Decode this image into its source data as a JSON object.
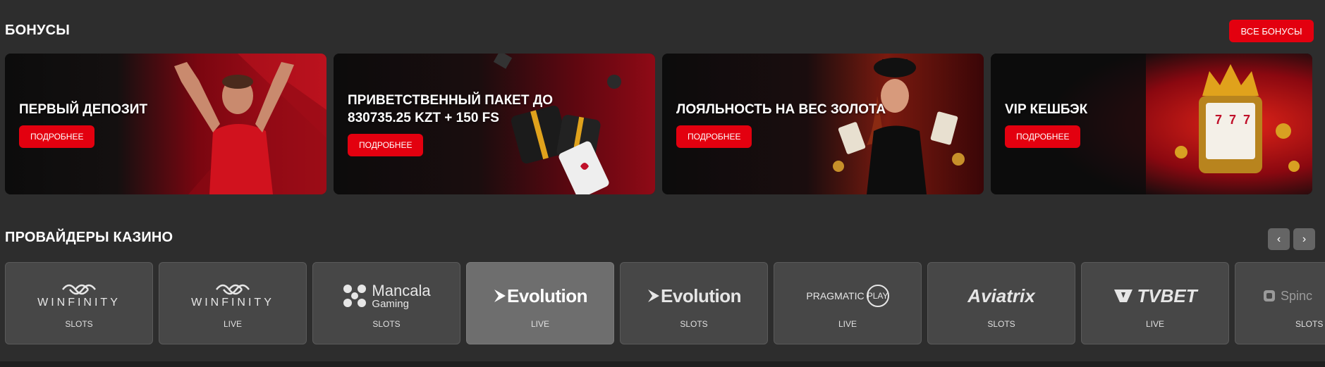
{
  "bonuses": {
    "title": "БОНУСЫ",
    "all_button": "ВСЕ БОНУСЫ",
    "cards": [
      {
        "title": "ПЕРВЫЙ ДЕПОЗИТ",
        "button": "ПОДРОБНЕЕ"
      },
      {
        "title": "ПРИВЕТСТВЕННЫЙ ПАКЕТ ДО 830735.25 KZT + 150 FS",
        "button": "ПОДРОБНЕЕ"
      },
      {
        "title": "ЛОЯЛЬНОСТЬ НА ВЕС ЗОЛОТА",
        "button": "ПОДРОБНЕЕ"
      },
      {
        "title": "VIP КЕШБЭК",
        "button": "ПОДРОБНЕЕ"
      }
    ]
  },
  "providers": {
    "title": "ПРОВАЙДЕРЫ КАЗИНО",
    "prev_icon": "‹",
    "next_icon": "›",
    "items": [
      {
        "logo": "WINFINITY",
        "category": "SLOTS"
      },
      {
        "logo": "WINFINITY",
        "category": "LIVE"
      },
      {
        "logo": "Mancala",
        "logo_sub": "Gaming",
        "category": "SLOTS"
      },
      {
        "logo": "Evolution",
        "category": "LIVE",
        "active": true
      },
      {
        "logo": "Evolution",
        "category": "SLOTS"
      },
      {
        "logo": "PRAGMATIC",
        "logo_sub": "PLAY",
        "category": "LIVE"
      },
      {
        "logo": "Aviatrix",
        "category": "SLOTS"
      },
      {
        "logo": "TVBET",
        "category": "LIVE"
      },
      {
        "logo": "Spinc",
        "category": "SLOTS"
      }
    ]
  },
  "colors": {
    "accent": "#e3000f",
    "background": "#2d2d2d",
    "card_bg": "#474747"
  }
}
